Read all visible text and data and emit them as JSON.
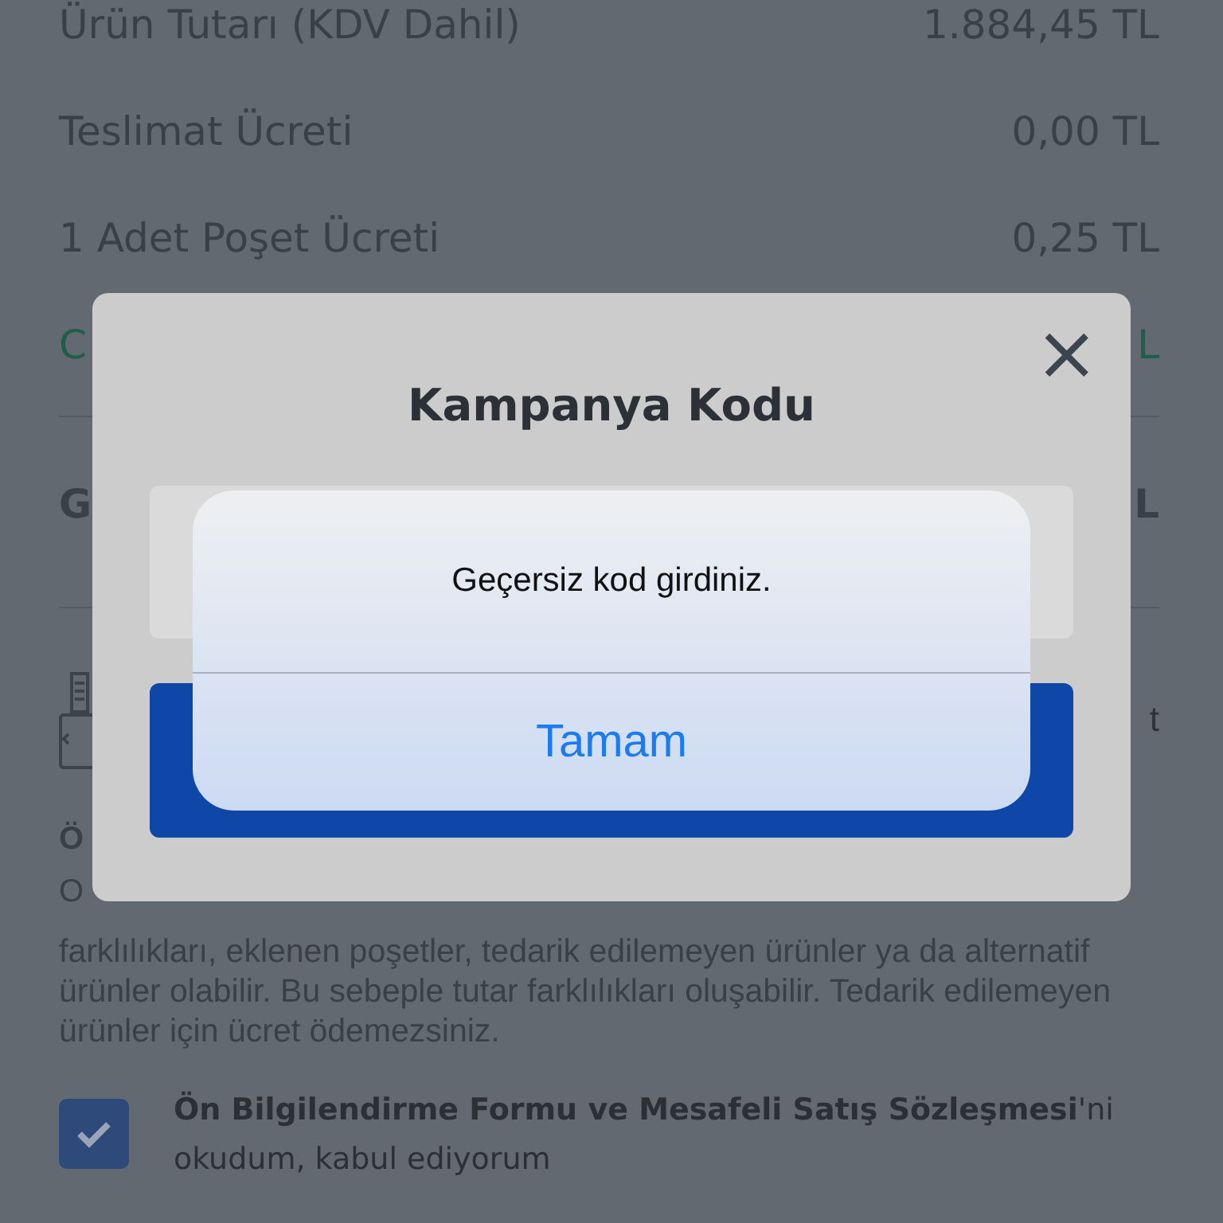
{
  "summary_rows": [
    {
      "label": "Ürün Tutarı (KDV Dahil)",
      "value": "1.884,45 TL",
      "kind": "normal"
    },
    {
      "label": "Teslimat Ücreti",
      "value": "0,00 TL",
      "kind": "normal"
    },
    {
      "label": "1 Adet Poşet Ücreti",
      "value": "0,25 TL",
      "kind": "normal"
    },
    {
      "label": "C",
      "value": "L",
      "kind": "discount"
    }
  ],
  "total_row": {
    "label": "G",
    "value": "L"
  },
  "info_row": {
    "text": "t"
  },
  "note": {
    "title": "Ö",
    "subtitle": "O",
    "paragraph": "farklılıkları, eklenen poşetler, tedarik edilemeyen ürünler ya da alternatif ürünler olabilir. Bu sebeple tutar farklılıkları oluşabilir. Tedarik edilemeyen ürünler için ücret ödemezsiniz."
  },
  "agreement": {
    "checked": true,
    "text": "**Ön Bilgilendirme Formu ve Mesafeli Satış Sözleşmesi**'ni okudum, kabul ediyorum"
  },
  "modal": {
    "title": "Kampanya Kodu",
    "close": "×"
  },
  "alert": {
    "message": "Geçersiz kod girdiniz.",
    "button": "Tamam"
  }
}
